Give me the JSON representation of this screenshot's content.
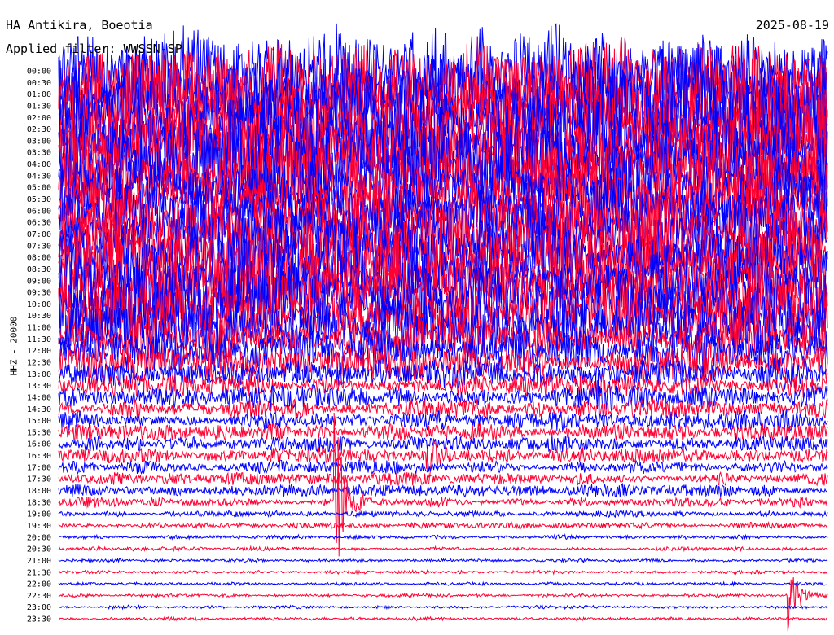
{
  "header": {
    "station": "HA Antikira, Boeotia",
    "date": "2025-08-19",
    "filter": "Applied filter: WWSSN-SP"
  },
  "chart_data": {
    "type": "line",
    "title": "HA Antikira, Boeotia",
    "ylabel": "HHZ - 20000",
    "time_labels": [
      "00:00",
      "00:30",
      "01:00",
      "01:30",
      "02:00",
      "02:30",
      "03:00",
      "03:30",
      "04:00",
      "04:30",
      "05:00",
      "05:30",
      "06:00",
      "06:30",
      "07:00",
      "07:30",
      "08:00",
      "08:30",
      "09:00",
      "09:30",
      "10:00",
      "10:30",
      "11:00",
      "11:30",
      "12:00",
      "12:30",
      "13:00",
      "13:30",
      "14:00",
      "14:30",
      "15:00",
      "15:30",
      "16:00",
      "16:30",
      "17:00",
      "17:30",
      "18:00",
      "18:30",
      "19:00",
      "19:30",
      "20:00",
      "20:30",
      "21:00",
      "21:30",
      "22:00",
      "22:30",
      "23:00",
      "23:30"
    ],
    "colors": [
      "#0000ff",
      "#ff0033"
    ],
    "trace_amplitude": [
      1.0,
      1.0,
      1.0,
      1.0,
      1.0,
      1.0,
      1.0,
      0.95,
      0.9,
      0.88,
      0.82,
      0.8,
      0.78,
      0.8,
      0.85,
      0.85,
      0.88,
      0.88,
      0.85,
      0.85,
      0.82,
      0.75,
      0.65,
      0.55,
      0.45,
      0.38,
      0.3,
      0.22,
      0.22,
      0.2,
      0.2,
      0.18,
      0.16,
      0.15,
      0.13,
      0.13,
      0.12,
      0.1,
      0.06,
      0.06,
      0.04,
      0.04,
      0.03,
      0.03,
      0.03,
      0.03,
      0.03,
      0.03
    ],
    "events": [
      {
        "trace": "18:30",
        "position": 0.36,
        "amplitude": 3.5
      },
      {
        "trace": "22:30",
        "position": 0.95,
        "amplitude": 1.5
      },
      {
        "trace": "16:30",
        "position": 0.48,
        "amplitude": 0.9
      },
      {
        "trace": "14:00",
        "position": 0.7,
        "amplitude": 0.8
      }
    ]
  }
}
